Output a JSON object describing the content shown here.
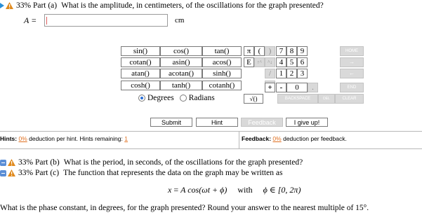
{
  "part_a": {
    "label": "33% Part (a)",
    "question": "What is the amplitude, in centimeters, of the oscillations for the graph presented?"
  },
  "answer": {
    "variable": "A =",
    "value": "",
    "unit": "cm"
  },
  "keypad": {
    "functions": [
      [
        "sin()",
        "cos()",
        "tan()"
      ],
      [
        "cotan()",
        "asin()",
        "acos()"
      ],
      [
        "atan()",
        "acotan()",
        "sinh()"
      ],
      [
        "cosh()",
        "tanh()",
        "cotanh()"
      ]
    ],
    "symbols": [
      "π",
      "(",
      ")",
      "E",
      "↑^",
      "^↓",
      "/",
      "*",
      "+",
      "-",
      "√()"
    ],
    "digits": [
      "7",
      "8",
      "9",
      "4",
      "5",
      "6",
      "1",
      "2",
      "3",
      "0",
      "."
    ],
    "side": [
      "HOME",
      "→",
      "←",
      "END",
      "BACKSPACE",
      "DEL",
      "CLEAR"
    ],
    "angle_modes": [
      "Degrees",
      "Radians"
    ],
    "selected_mode": "Degrees"
  },
  "buttons": {
    "submit": "Submit",
    "hint": "Hint",
    "feedback": "Feedback",
    "give_up": "I give up!"
  },
  "hints": {
    "label": "Hints:",
    "pct": "0%",
    "text": "deduction per hint. Hints remaining:",
    "remaining": "1"
  },
  "feedback": {
    "label": "Feedback:",
    "pct": "0%",
    "text": "deduction per feedback."
  },
  "part_b": {
    "label": "33% Part (b)",
    "question": "What is the period, in seconds, of the oscillations for the graph presented?"
  },
  "part_c": {
    "label": "33% Part (c)",
    "question": "The function that represents the data on the graph may be written as"
  },
  "formula": {
    "lhs": "x",
    "rhs": "A cos(ωt + ϕ)",
    "with": "with",
    "cond": "ϕ ∈ [0, 2π)"
  },
  "final_question": "What is the phase constant, in degrees, for the graph presented? Round your answer to the nearest multiple of 15°.",
  "colors": {
    "accent": "#2a8fd8",
    "warning": "#e08a1e",
    "link": "#e07020",
    "disabled": "#d9d9d9"
  }
}
